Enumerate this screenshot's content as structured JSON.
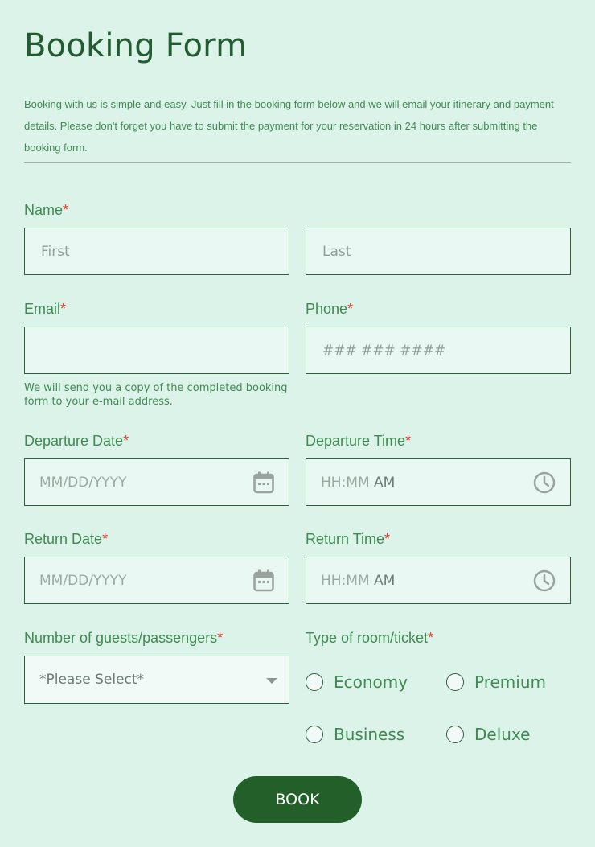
{
  "form": {
    "title": "Booking Form",
    "intro": "Booking with us is simple and easy. Just fill in the booking form below and we will email your itinerary and payment details.  Please don't forget you have to submit the payment for your reservation in 24 hours after submitting the booking form.",
    "required_marker": "*"
  },
  "name": {
    "label": "Name",
    "first_placeholder": "First",
    "last_placeholder": "Last"
  },
  "email": {
    "label": "Email",
    "value": "",
    "help": "We will send you a copy of the completed booking form to your e-mail address."
  },
  "phone": {
    "label": "Phone",
    "placeholder": "### ### ####"
  },
  "departure_date": {
    "label": "Departure Date",
    "placeholder": "MM/DD/YYYY",
    "icon": "calendar-icon"
  },
  "departure_time": {
    "label": "Departure Time",
    "placeholder_time": "HH:MM",
    "placeholder_ampm": "AM",
    "icon": "clock-icon"
  },
  "return_date": {
    "label": "Return Date",
    "placeholder": "MM/DD/YYYY",
    "icon": "calendar-icon"
  },
  "return_time": {
    "label": "Return Time",
    "placeholder_time": "HH:MM",
    "placeholder_ampm": "AM",
    "icon": "clock-icon"
  },
  "guests": {
    "label": "Number of guests/passengers",
    "selected": "*Please Select*"
  },
  "room": {
    "label": "Type of room/ticket",
    "options": [
      "Economy",
      "Premium",
      "Business",
      "Deluxe"
    ]
  },
  "submit": {
    "label": "BOOK"
  },
  "colors": {
    "background": "#dcf3ea",
    "accent": "#236029",
    "label": "#3f8a52",
    "required": "#e33b2a"
  }
}
